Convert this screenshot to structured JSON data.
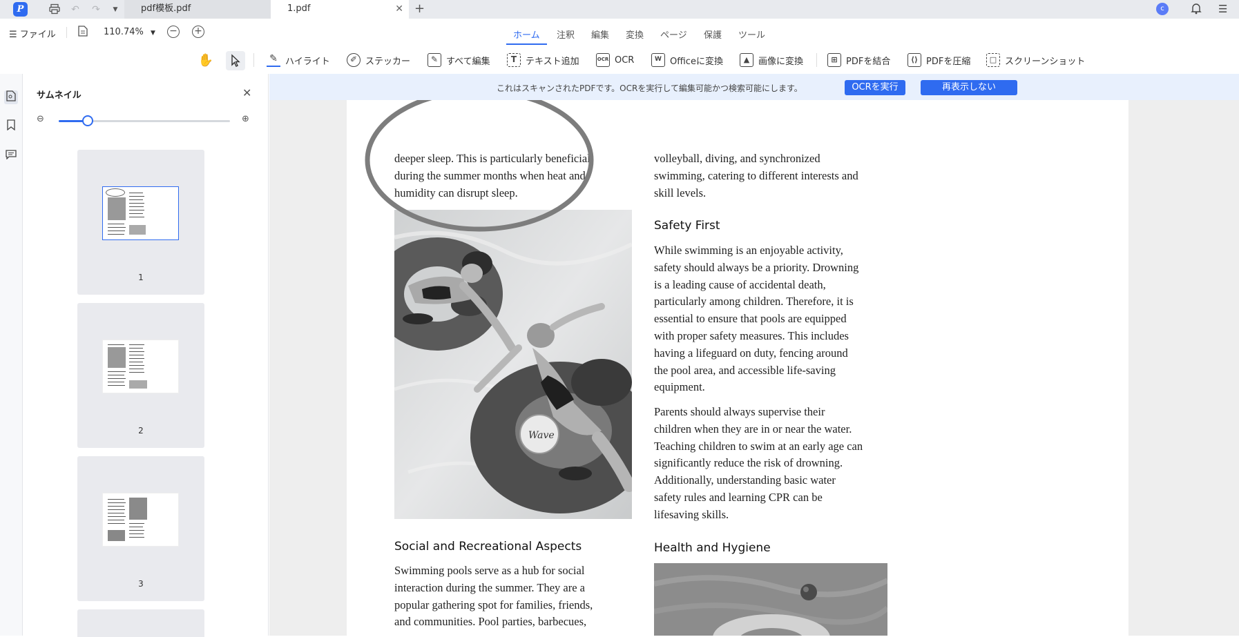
{
  "tabs": [
    {
      "label": "pdf模板.pdf"
    },
    {
      "label": "1.pdf"
    }
  ],
  "menu": {
    "file_label": "ファイル",
    "zoom": "110.74%",
    "nav_tabs": [
      "ホーム",
      "注釈",
      "編集",
      "変換",
      "ページ",
      "保護",
      "ツール"
    ]
  },
  "user": {
    "initial": "c"
  },
  "toolbar": {
    "tools": [
      {
        "label": "ハイライト",
        "icon": "highlight-icon"
      },
      {
        "label": "ステッカー",
        "icon": "sticker-icon"
      },
      {
        "label": "すべて編集",
        "icon": "edit-all-icon"
      },
      {
        "label": "テキスト追加",
        "icon": "add-text-icon"
      },
      {
        "label": "OCR",
        "icon": "ocr-icon"
      },
      {
        "label": "Officeに変換",
        "icon": "office-convert-icon"
      },
      {
        "label": "画像に変換",
        "icon": "image-convert-icon"
      },
      {
        "label": "PDFを結合",
        "icon": "merge-icon"
      },
      {
        "label": "PDFを圧縮",
        "icon": "compress-icon"
      },
      {
        "label": "スクリーンショット",
        "icon": "screenshot-icon"
      }
    ],
    "ocr_icon_text": "OCR"
  },
  "thumbnails": {
    "title": "サムネイル",
    "slider_fraction": 0.17,
    "pages": [
      "1",
      "2",
      "3"
    ]
  },
  "ocr_banner": {
    "message": "これはスキャンされたPDFです。OCRを実行して編集可能かつ検索可能にします。",
    "run_label": "OCRを実行",
    "dismiss_label": "再表示しない"
  },
  "document": {
    "left_para1": [
      "deeper sleep. This is particularly beneficial",
      "during the summer months when heat and",
      "humidity can disrupt sleep."
    ],
    "social_heading": "Social and Recreational Aspects",
    "social_para": [
      "Swimming pools serve as a hub for social",
      "interaction during the summer. They are a",
      "popular gathering spot for families, friends,",
      "and communities. Pool parties, barbecues,"
    ],
    "right_para1": [
      "volleyball, diving, and synchronized",
      "swimming, catering to different interests and",
      "skill levels."
    ],
    "safety_heading": "Safety First",
    "safety_para": [
      "While swimming is an enjoyable activity,",
      "safety should always be a priority. Drowning",
      "is a leading cause of accidental death,",
      "particularly among children. Therefore, it is",
      "essential to ensure that pools are equipped",
      "with proper safety measures. This includes",
      "having a lifeguard on duty, fencing around",
      "the pool area, and accessible life-saving",
      "equipment."
    ],
    "parents_para": [
      "Parents should always supervise their",
      "children when they are in or near the water.",
      "Teaching children to swim at an early age can",
      "significantly reduce the risk of drowning.",
      "Additionally, understanding basic water",
      "safety rules and learning CPR can be",
      "lifesaving skills."
    ],
    "health_heading": "Health and Hygiene",
    "float_brand": "Wave"
  }
}
